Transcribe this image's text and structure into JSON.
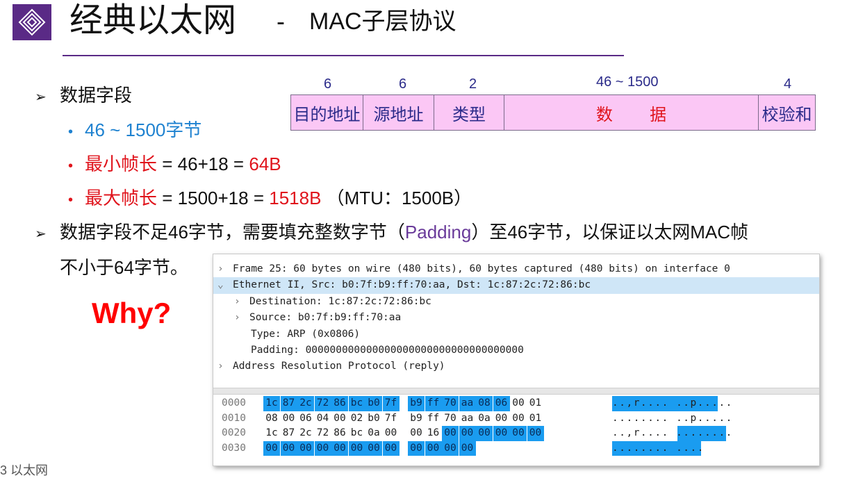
{
  "header": {
    "title": "经典以太网",
    "dash": "-",
    "subtitle": "MAC子层协议"
  },
  "bullets": {
    "b1": "数据字段",
    "b1_1": "46 ~ 1500字节",
    "b1_2_term": "最小帧长",
    "b1_2_expr": " = 46+18 = ",
    "b1_2_val": "64B",
    "b1_3_term": "最大帧长",
    "b1_3_expr": " = 1500+18 = ",
    "b1_3_val": "1518B",
    "b1_3_note": " （MTU：1500B）",
    "b2_a": "数据字段不足46字节，需要填充整数字节（",
    "b2_pad": "Padding",
    "b2_b": "）至46字节，以保证以太网MAC帧",
    "b2_c": "不小于64字节。",
    "why": "Why?"
  },
  "frame": {
    "sizes": [
      "6",
      "6",
      "2",
      "46 ~ 1500",
      "4"
    ],
    "fields": [
      "目的地址",
      "源地址",
      "类型",
      "数        据",
      "校验和"
    ]
  },
  "wireshark": {
    "tree": [
      "Frame 25: 60 bytes on wire (480 bits), 60 bytes captured (480 bits) on interface 0",
      "Ethernet II, Src: b0:7f:b9:ff:70:aa, Dst: 1c:87:2c:72:86:bc",
      "Destination: 1c:87:2c:72:86:bc",
      "Source: b0:7f:b9:ff:70:aa",
      "Type: ARP (0x0806)",
      "Padding: 000000000000000000000000000000000000",
      "Address Resolution Protocol (reply)"
    ],
    "hex": [
      {
        "offset": "0000",
        "bytes": [
          "1c",
          "87",
          "2c",
          "72",
          "86",
          "bc",
          "b0",
          "7f",
          "b9",
          "ff",
          "70",
          "aa",
          "08",
          "06",
          "00",
          "01"
        ],
        "ascii": "..,r.... ..p....."
      },
      {
        "offset": "0010",
        "bytes": [
          "08",
          "00",
          "06",
          "04",
          "00",
          "02",
          "b0",
          "7f",
          "b9",
          "ff",
          "70",
          "aa",
          "0a",
          "00",
          "00",
          "01"
        ],
        "ascii": "........ ..p....."
      },
      {
        "offset": "0020",
        "bytes": [
          "1c",
          "87",
          "2c",
          "72",
          "86",
          "bc",
          "0a",
          "00",
          "00",
          "16",
          "00",
          "00",
          "00",
          "00",
          "00",
          "00"
        ],
        "ascii": "..,r.... ........"
      },
      {
        "offset": "0030",
        "bytes": [
          "00",
          "00",
          "00",
          "00",
          "00",
          "00",
          "00",
          "00",
          "00",
          "00",
          "00",
          "00"
        ],
        "ascii": "........ ...."
      }
    ]
  },
  "footer": {
    "text": "3 以太网"
  },
  "colors": {
    "accent": "#5a2a86",
    "field_fill": "#fbc7f5",
    "highlight": "#1a9cf0",
    "red": "#e0141c",
    "blue": "#1f82d0"
  }
}
